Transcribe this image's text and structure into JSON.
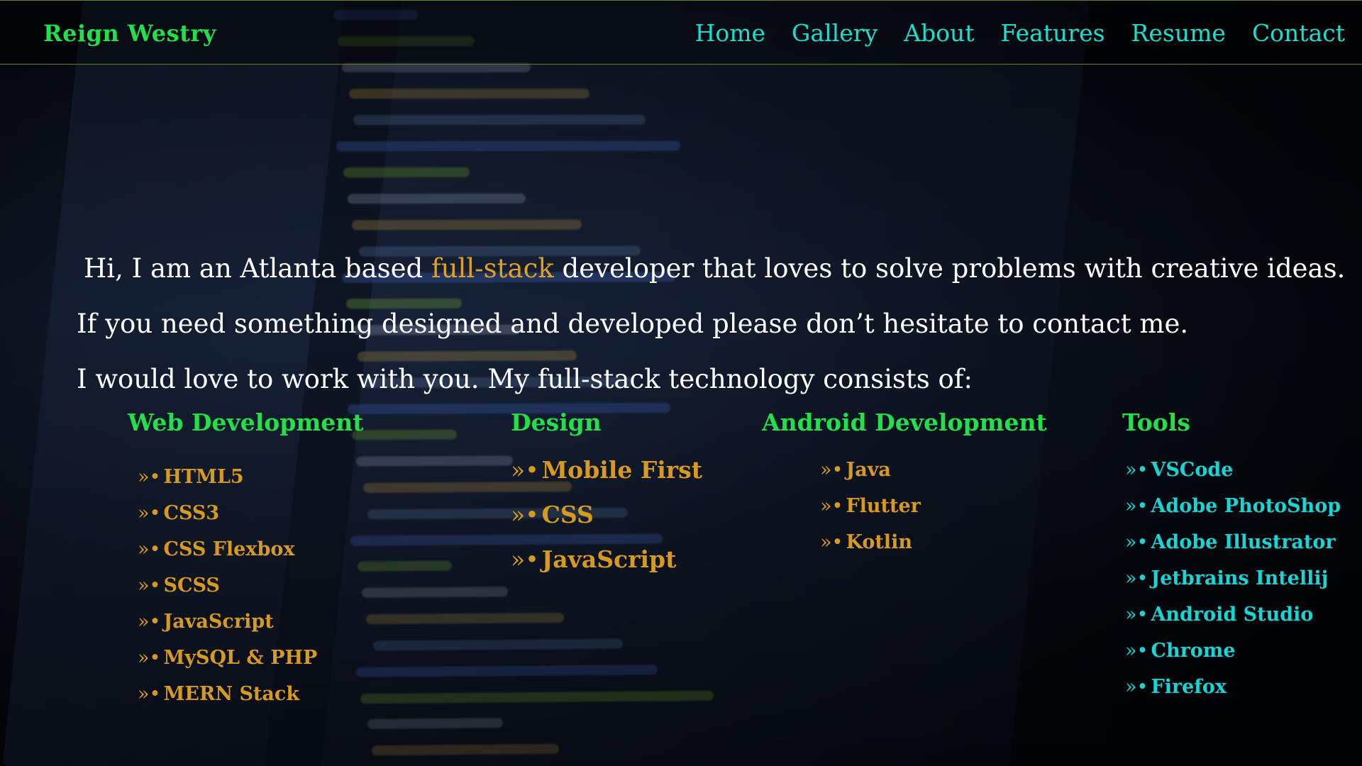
{
  "brand": "Reign Westry",
  "nav": [
    "Home",
    "Gallery",
    "About",
    "Features",
    "Resume",
    "Contact"
  ],
  "intro": {
    "line1_before": "Hi, I am an Atlanta based ",
    "line1_accent": "full-stack",
    "line1_after": " developer that loves to solve problems with creative ideas.",
    "line2": "If you need something designed and developed please don’t hesitate to contact me.",
    "line3": "I would love to work with you. My full-stack technology consists of:"
  },
  "bullet_mark": "»•",
  "columns": {
    "web": {
      "title": "Web Development",
      "items": [
        "HTML5",
        "CSS3",
        "CSS Flexbox",
        "SCSS",
        "JavaScript",
        "MySQL & PHP",
        "MERN Stack"
      ]
    },
    "design": {
      "title": "Design",
      "items": [
        "Mobile First",
        "CSS",
        "JavaScript"
      ]
    },
    "android": {
      "title": "Android Development",
      "items": [
        "Java",
        "Flutter",
        "Kotlin"
      ]
    },
    "tools": {
      "title": "Tools",
      "items": [
        "VSCode",
        "Adobe PhotoShop",
        "Adobe Illustrator",
        "Jetbrains Intellij",
        "Android Studio",
        "Chrome",
        "Firefox"
      ]
    }
  },
  "colors": {
    "brand_green": "#22e04a",
    "nav_cyan": "#18e0d0",
    "accent_orange": "#e0a020",
    "tools_cyan": "#18d4d4",
    "nav_border": "#6b7d22"
  }
}
